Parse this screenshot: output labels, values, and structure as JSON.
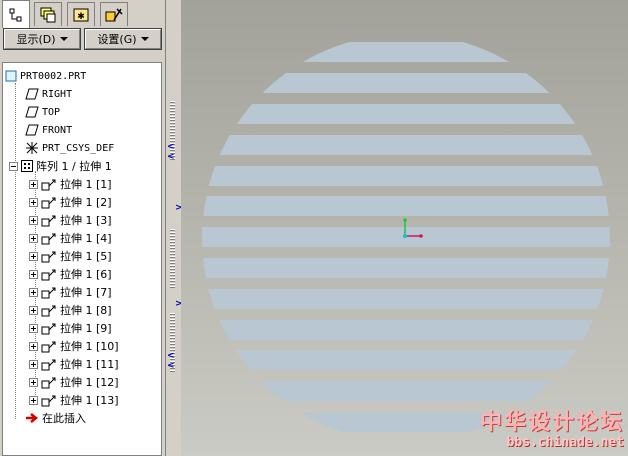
{
  "tabs": [
    {
      "icon": "model-tree-icon"
    },
    {
      "icon": "layers-icon"
    },
    {
      "icon": "favorites-icon"
    },
    {
      "icon": "tools-icon"
    }
  ],
  "menu": {
    "show_label": "显示(D)",
    "settings_label": "设置(G)"
  },
  "tree": {
    "root": "PRT0002.PRT",
    "datums": [
      {
        "label": "RIGHT",
        "icon": "datum-plane-icon"
      },
      {
        "label": "TOP",
        "icon": "datum-plane-icon"
      },
      {
        "label": "FRONT",
        "icon": "datum-plane-icon"
      },
      {
        "label": "PRT_CSYS_DEF",
        "icon": "coordinate-system-icon"
      }
    ],
    "pattern": "阵列 1 / 拉伸 1",
    "extrudes": [
      "拉伸 1 [1]",
      "拉伸 1 [2]",
      "拉伸 1 [3]",
      "拉伸 1 [4]",
      "拉伸 1 [5]",
      "拉伸 1 [6]",
      "拉伸 1 [7]",
      "拉伸 1 [8]",
      "拉伸 1 [9]",
      "拉伸 1 [10]",
      "拉伸 1 [11]",
      "拉伸 1 [12]",
      "拉伸 1 [13]"
    ],
    "insert_here": "在此插入"
  },
  "watermark": {
    "title": "中华设计论坛",
    "url": "bbs.chinade.net"
  },
  "colors": {
    "stripe": "#b8c7d1",
    "background": "#b6b6ae",
    "axis_x": "#d4145a",
    "axis_y": "#17c940",
    "axis_z": "#20c0d0",
    "insert_arrow": "#d40000"
  }
}
